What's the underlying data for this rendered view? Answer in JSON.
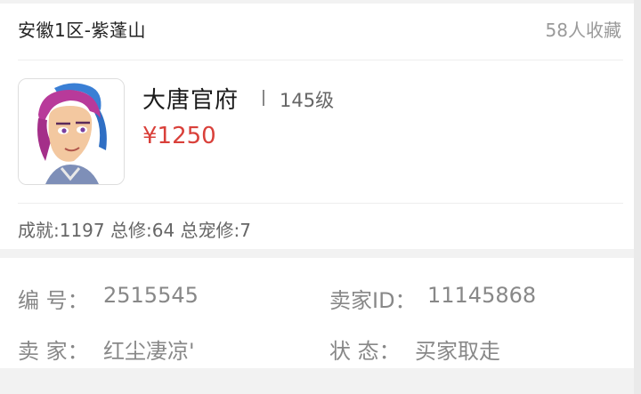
{
  "listing": {
    "server": "安徽1区-紫蓬山",
    "favorites": "58人收藏",
    "school": "大唐官府",
    "level": "145级",
    "price": "¥1250",
    "stats": "成就:1197 总修:64 总宠修:7"
  },
  "details": {
    "id_label": "编 号：",
    "id_value": "2515545",
    "seller_id_label": "卖家ID：",
    "seller_id_value": "11145868",
    "seller_label": "卖 家：",
    "seller_value": "红尘凄凉'",
    "status_label": "状 态：",
    "status_value": "买家取走"
  },
  "colors": {
    "price": "#d9403a",
    "muted": "#888888",
    "text": "#222222"
  }
}
